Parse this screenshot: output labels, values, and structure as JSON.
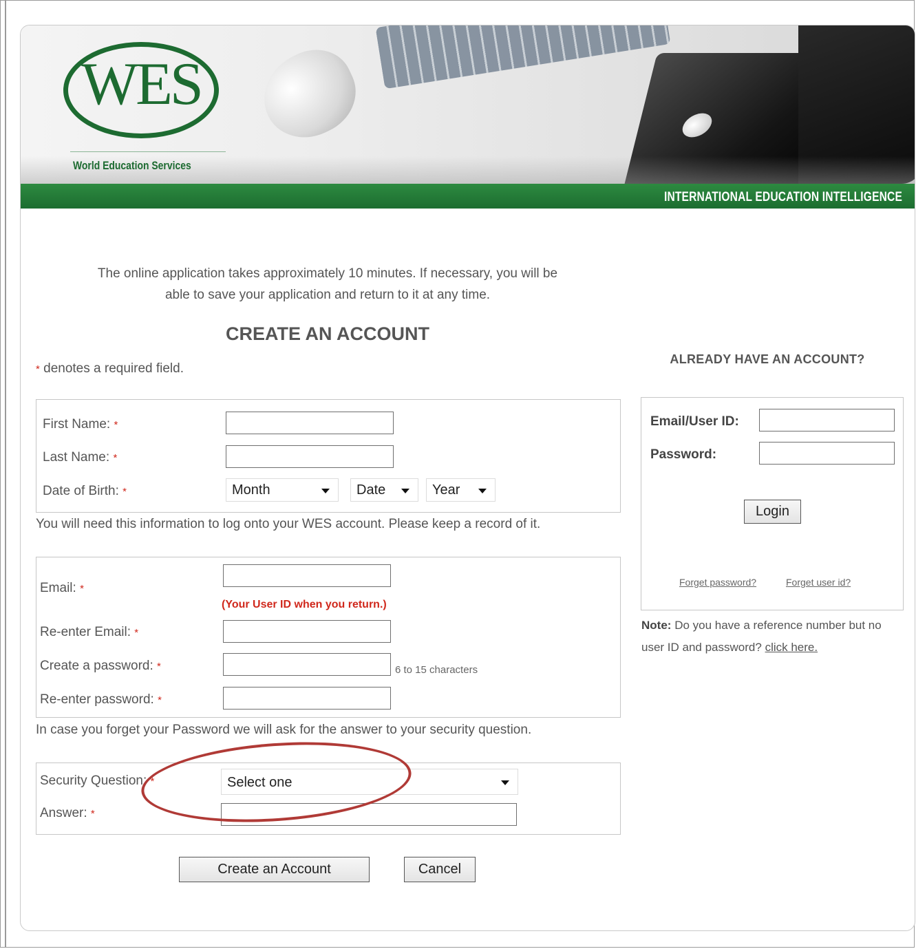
{
  "banner": {
    "logo_text": "WES",
    "logo_subtitle": "World Education Services",
    "tagline": "INTERNATIONAL EDUCATION INTELLIGENCE"
  },
  "intro": {
    "line1": "The online application takes approximately 10 minutes. If necessary, you will be",
    "line2": "able to save your application and return to it at any time."
  },
  "create": {
    "heading": "CREATE AN ACCOUNT",
    "required_star": "*",
    "required_note": "denotes a required field.",
    "first_name_label": "First Name:",
    "last_name_label": "Last Name:",
    "dob_label": "Date of Birth:",
    "dob_month": "Month",
    "dob_date": "Date",
    "dob_year": "Year",
    "login_info_note": "You will need this information to log onto your WES account. Please keep a record of it.",
    "email_label": "Email:",
    "email_note": "(Your User ID when you return.)",
    "reenter_email_label": "Re-enter Email:",
    "password_label": "Create a password:",
    "password_hint": "6 to 15 characters",
    "reenter_password_label": "Re-enter password:",
    "security_note": "In case you forget your Password we will ask for the answer to your security question.",
    "security_question_label": "Security Question:",
    "security_question_value": "Select one",
    "answer_label": "Answer:",
    "submit_label": "Create an Account",
    "cancel_label": "Cancel"
  },
  "login": {
    "heading": "ALREADY HAVE AN ACCOUNT?",
    "user_label": "Email/User ID:",
    "password_label": "Password:",
    "login_button": "Login",
    "forgot_password": "Forget password?",
    "forgot_user": "Forget user id?",
    "note_bold": "Note:",
    "note_text": "Do you have a reference number but no user ID and password?",
    "note_link": "click here."
  },
  "colors": {
    "brand_green": "#1d6b31",
    "required_red": "#d0281c",
    "annotation_red": "#b03a36"
  }
}
